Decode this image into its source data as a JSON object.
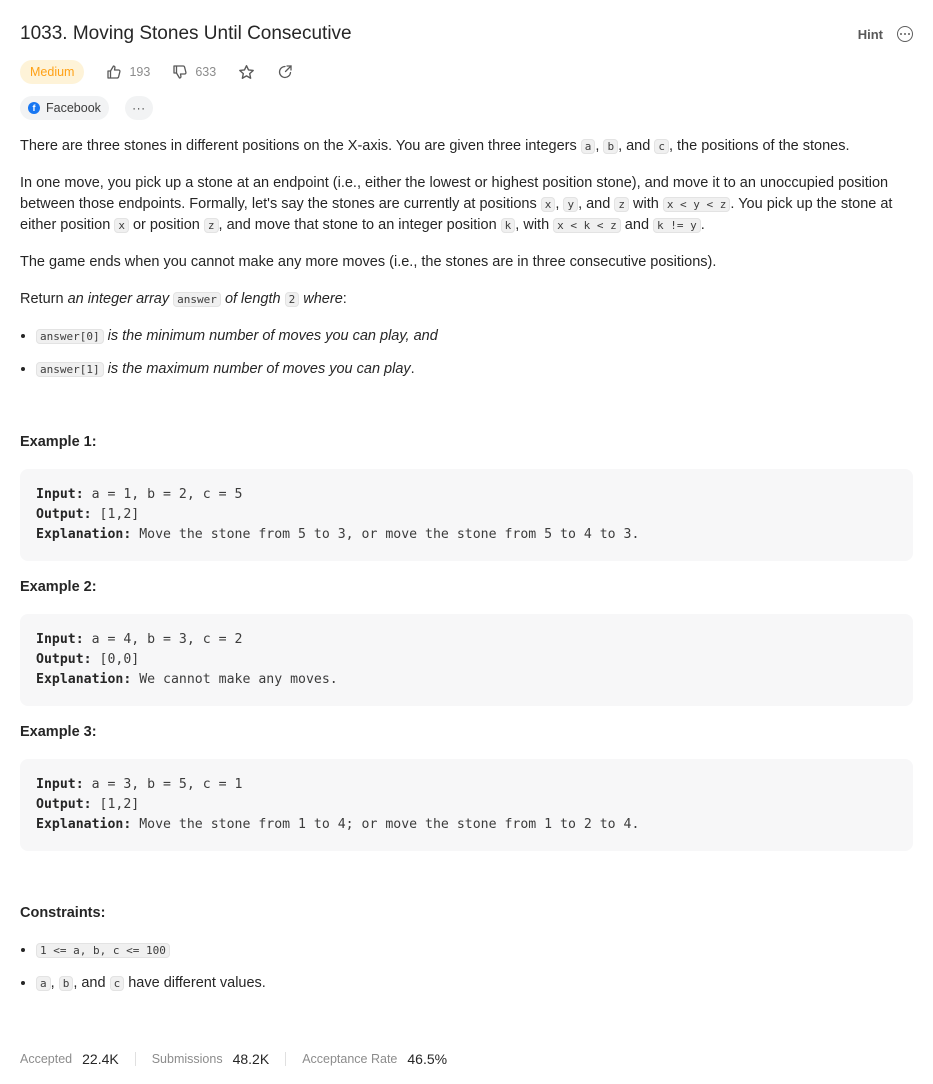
{
  "problem": {
    "title": "1033. Moving Stones Until Consecutive",
    "hint_label": "Hint",
    "difficulty": "Medium",
    "likes": "193",
    "dislikes": "633",
    "company": "Facebook",
    "company_more": "···"
  },
  "description": {
    "p1_a": "There are three stones in different positions on the X-axis. You are given three integers ",
    "p1_code_a": "a",
    "p1_b": ", ",
    "p1_code_b": "b",
    "p1_c": ", and ",
    "p1_code_c": "c",
    "p1_d": ", the positions of the stones.",
    "p2_a": "In one move, you pick up a stone at an endpoint (i.e., either the lowest or highest position stone), and move it to an unoccupied position between those endpoints. Formally, let's say the stones are currently at positions ",
    "p2_code_x": "x",
    "p2_b": ", ",
    "p2_code_y": "y",
    "p2_c": ", and ",
    "p2_code_z": "z",
    "p2_d": " with ",
    "p2_code_xyz": "x < y < z",
    "p2_e": ". You pick up the stone at either position ",
    "p2_code_x2": "x",
    "p2_f": " or position ",
    "p2_code_z2": "z",
    "p2_g": ", and move that stone to an integer position ",
    "p2_code_k": "k",
    "p2_h": ", with ",
    "p2_code_xkz": "x < k < z",
    "p2_i": " and ",
    "p2_code_kny": "k != y",
    "p2_j": ".",
    "p3": "The game ends when you cannot make any more moves (i.e., the stones are in three consecutive positions).",
    "p4_a": "Return ",
    "p4_em1": "an integer array",
    "p4_code": "answer",
    "p4_em2": "of length",
    "p4_code2": "2",
    "p4_em3": "where",
    "p4_b": ":",
    "b1_code": "answer[0]",
    "b1_text": "is the minimum number of moves you can play, and",
    "b2_code": "answer[1]",
    "b2_text": "is the maximum number of moves you can play",
    "b2_end": "."
  },
  "examples": [
    {
      "title": "Example 1:",
      "input_label": "Input:",
      "input": "a = 1, b = 2, c = 5",
      "output_label": "Output:",
      "output": "[1,2]",
      "explanation_label": "Explanation:",
      "explanation": "Move the stone from 5 to 3, or move the stone from 5 to 4 to 3."
    },
    {
      "title": "Example 2:",
      "input_label": "Input:",
      "input": "a = 4, b = 3, c = 2",
      "output_label": "Output:",
      "output": "[0,0]",
      "explanation_label": "Explanation:",
      "explanation": "We cannot make any moves."
    },
    {
      "title": "Example 3:",
      "input_label": "Input:",
      "input": "a = 3, b = 5, c = 1",
      "output_label": "Output:",
      "output": "[1,2]",
      "explanation_label": "Explanation:",
      "explanation": "Move the stone from 1 to 4; or move the stone from 1 to 2 to 4."
    }
  ],
  "constraints": {
    "title": "Constraints:",
    "c1_code": "1 <= a, b, c <= 100",
    "c2_code_a": "a",
    "c2_sep1": ", ",
    "c2_code_b": "b",
    "c2_sep2": ", and ",
    "c2_code_c": "c",
    "c2_text": " have different values."
  },
  "stats": {
    "accepted_label": "Accepted",
    "accepted": "22.4K",
    "submissions_label": "Submissions",
    "submissions": "48.2K",
    "acceptance_label": "Acceptance Rate",
    "acceptance": "46.5%"
  },
  "colors": {
    "difficulty_medium": "#ffa116",
    "difficulty_bg": "#fef3d8",
    "facebook": "#1877f2"
  },
  "icons": [
    "thumbs-up-icon",
    "thumbs-down-icon",
    "star-icon",
    "share-icon",
    "more-icon",
    "facebook-icon"
  ]
}
